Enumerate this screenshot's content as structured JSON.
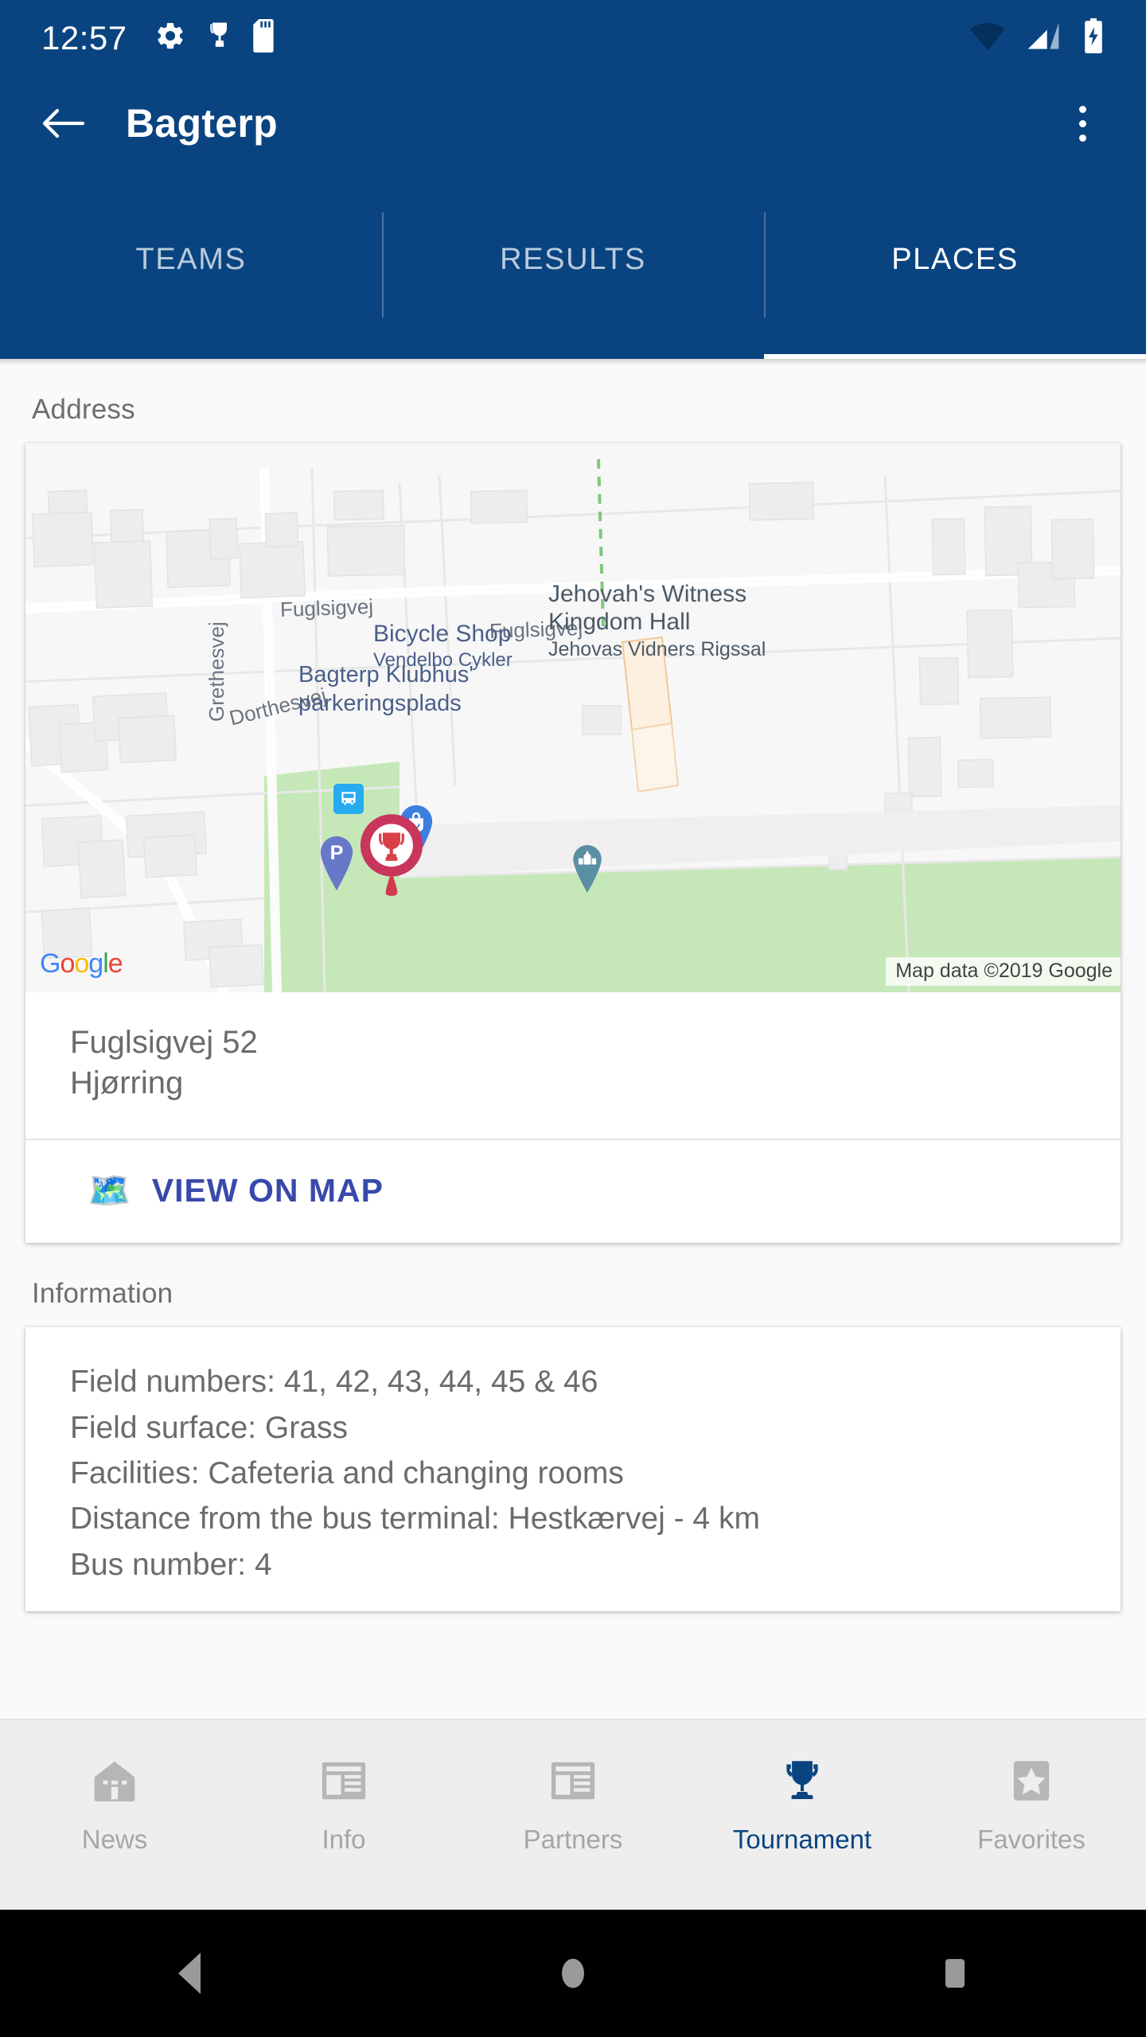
{
  "statusbar": {
    "time": "12:57",
    "left_icons": [
      "gear-icon",
      "trophy-icon",
      "sd-card-icon"
    ],
    "right_icons": [
      "wifi-icon",
      "cellular-signal-icon",
      "battery-charging-icon"
    ]
  },
  "appbar": {
    "back_icon": "arrow-left-icon",
    "title": "Bagterp",
    "overflow_icon": "more-vertical-icon"
  },
  "tabs": [
    {
      "label": "TEAMS",
      "active": false
    },
    {
      "label": "RESULTS",
      "active": false
    },
    {
      "label": "PLACES",
      "active": true
    }
  ],
  "sections": {
    "address_label": "Address",
    "information_label": "Information"
  },
  "map": {
    "logo_text": "Google",
    "attribution": "Map data ©2019 Google",
    "streets": [
      "Fuglsigvej",
      "Fuglsigvej",
      "Dorthesvej",
      "Grethesvej"
    ],
    "labels": {
      "street_fuglsigvej_left": "Fuglsigvej",
      "street_fuglsigvej_right": "Fuglsigvej",
      "street_dorthesvej": "Dorthesvej",
      "street_grethesvej": "Grethesvej",
      "poi_parking_line1": "Bagterp Klubhus'",
      "poi_parking_line2": "parkeringsplads",
      "poi_bicycle_line1": "Bicycle Shop",
      "poi_bicycle_line2": "Vendelbo Cykler",
      "poi_hall_line1": "Jehovah's Witness",
      "poi_hall_line2": "Kingdom Hall",
      "poi_hall_line3": "Jehovas Vidners Rigssal"
    },
    "markers": [
      {
        "name": "venue-trophy-marker",
        "icon": "trophy-marker",
        "color": "#D93B4A"
      },
      {
        "name": "parking-marker",
        "icon": "parking-marker",
        "color": "#6878C8"
      },
      {
        "name": "bicycle-shop-marker",
        "icon": "shop-marker",
        "color": "#3C7FE0"
      },
      {
        "name": "kingdom-hall-marker",
        "icon": "church-marker",
        "color": "#5b8fa3"
      },
      {
        "name": "bus-stop-marker",
        "icon": "bus-icon",
        "color": "#26aaf0"
      }
    ]
  },
  "address": {
    "street": "Fuglsigvej 52",
    "city": "Hjørring",
    "view_on_map_label": "VIEW ON MAP",
    "view_on_map_icon": "🗺️"
  },
  "information": {
    "lines": [
      "Field numbers: 41, 42, 43, 44, 45 & 46",
      "Field surface: Grass",
      "Facilities: Cafeteria and changing rooms",
      "Distance from the bus terminal: Hestkærvej - 4 km",
      "Bus number: 4"
    ]
  },
  "bottom_nav": [
    {
      "label": "News",
      "icon": "home-icon",
      "active": false
    },
    {
      "label": "Info",
      "icon": "article-icon",
      "active": false
    },
    {
      "label": "Partners",
      "icon": "article-icon",
      "active": false
    },
    {
      "label": "Tournament",
      "icon": "trophy-icon",
      "active": true
    },
    {
      "label": "Favorites",
      "icon": "star-icon",
      "active": false
    }
  ],
  "android_nav": [
    {
      "label": "back",
      "icon": "triangle-back-icon"
    },
    {
      "label": "home",
      "icon": "circle-home-icon"
    },
    {
      "label": "recents",
      "icon": "square-recents-icon"
    }
  ],
  "colors": {
    "primary": "#0a4480",
    "accent": "#3949ab",
    "inactive": "#a6a6a6",
    "text": "#6b6b6b"
  }
}
